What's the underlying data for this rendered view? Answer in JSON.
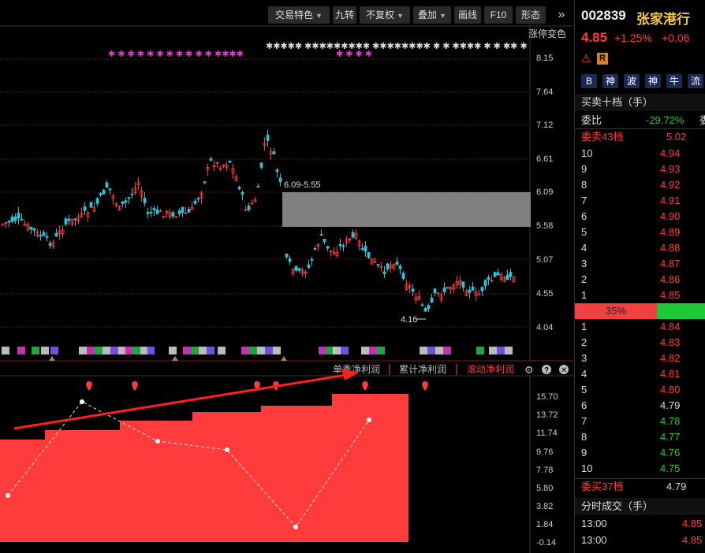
{
  "toolbar": {
    "items": [
      "交易特色",
      "九转",
      "不复权",
      "叠加",
      "画线",
      "F10",
      "形态"
    ],
    "more_icon": "double-chevron-right-icon"
  },
  "chart": {
    "limit_label": "涨停变色",
    "price_ticks": [
      "8.15",
      "7.64",
      "7.12",
      "6.61",
      "6.09",
      "5.58",
      "5.07",
      "4.55",
      "4.04"
    ],
    "box_label": "6.09-5.55",
    "low_label": "4.16",
    "tab_labels": [
      "单季净利润",
      "累计净利润",
      "滚动净利润"
    ],
    "icons": [
      "gear-icon",
      "help-icon",
      "close-icon"
    ],
    "profit_ticks": [
      "15.70",
      "13.72",
      "11.74",
      "9.76",
      "7.78",
      "5.80",
      "3.82",
      "1.84",
      "-0.14"
    ],
    "colors": {
      "up": "#ff3b3b",
      "down": "#22c7d9",
      "bars": "#ff3b3b",
      "box": "#808080",
      "pink": "#e23bcf"
    }
  },
  "stock": {
    "code": "002839",
    "name": "张家港行",
    "price": "4.85",
    "change_pct": "+1.25%",
    "change": "+0.06",
    "warning_icon": "warning-icon",
    "badge": "R",
    "buttons": [
      "B",
      "神",
      "波",
      "神",
      "牛",
      "流"
    ]
  },
  "orderbook": {
    "title": "买卖十档（手）",
    "ratio_label": "委比",
    "ratio_value": "-29.72%",
    "ratio_cut": "委",
    "sell_header": "委卖43档",
    "sell_header_price": "5.02",
    "sells": [
      {
        "lvl": "10",
        "price": "4.94"
      },
      {
        "lvl": "9",
        "price": "4.93"
      },
      {
        "lvl": "8",
        "price": "4.92"
      },
      {
        "lvl": "7",
        "price": "4.91"
      },
      {
        "lvl": "6",
        "price": "4.90"
      },
      {
        "lvl": "5",
        "price": "4.89"
      },
      {
        "lvl": "4",
        "price": "4.88"
      },
      {
        "lvl": "3",
        "price": "4.87"
      },
      {
        "lvl": "2",
        "price": "4.86"
      },
      {
        "lvl": "1",
        "price": "4.85"
      }
    ],
    "bar_pct": "35%",
    "buys": [
      {
        "lvl": "1",
        "price": "4.84"
      },
      {
        "lvl": "2",
        "price": "4.83"
      },
      {
        "lvl": "3",
        "price": "4.82"
      },
      {
        "lvl": "4",
        "price": "4.81"
      },
      {
        "lvl": "5",
        "price": "4.80"
      },
      {
        "lvl": "6",
        "price": "4.79"
      },
      {
        "lvl": "7",
        "price": "4.78"
      },
      {
        "lvl": "8",
        "price": "4.77"
      },
      {
        "lvl": "9",
        "price": "4.76"
      },
      {
        "lvl": "10",
        "price": "4.75"
      }
    ],
    "buy_header": "委买37档",
    "buy_header_price": "4.79"
  },
  "trades": {
    "title": "分时成交（手）",
    "rows": [
      {
        "time": "13:00",
        "price": "4.85"
      },
      {
        "time": "13:00",
        "price": "4.85"
      }
    ]
  }
}
